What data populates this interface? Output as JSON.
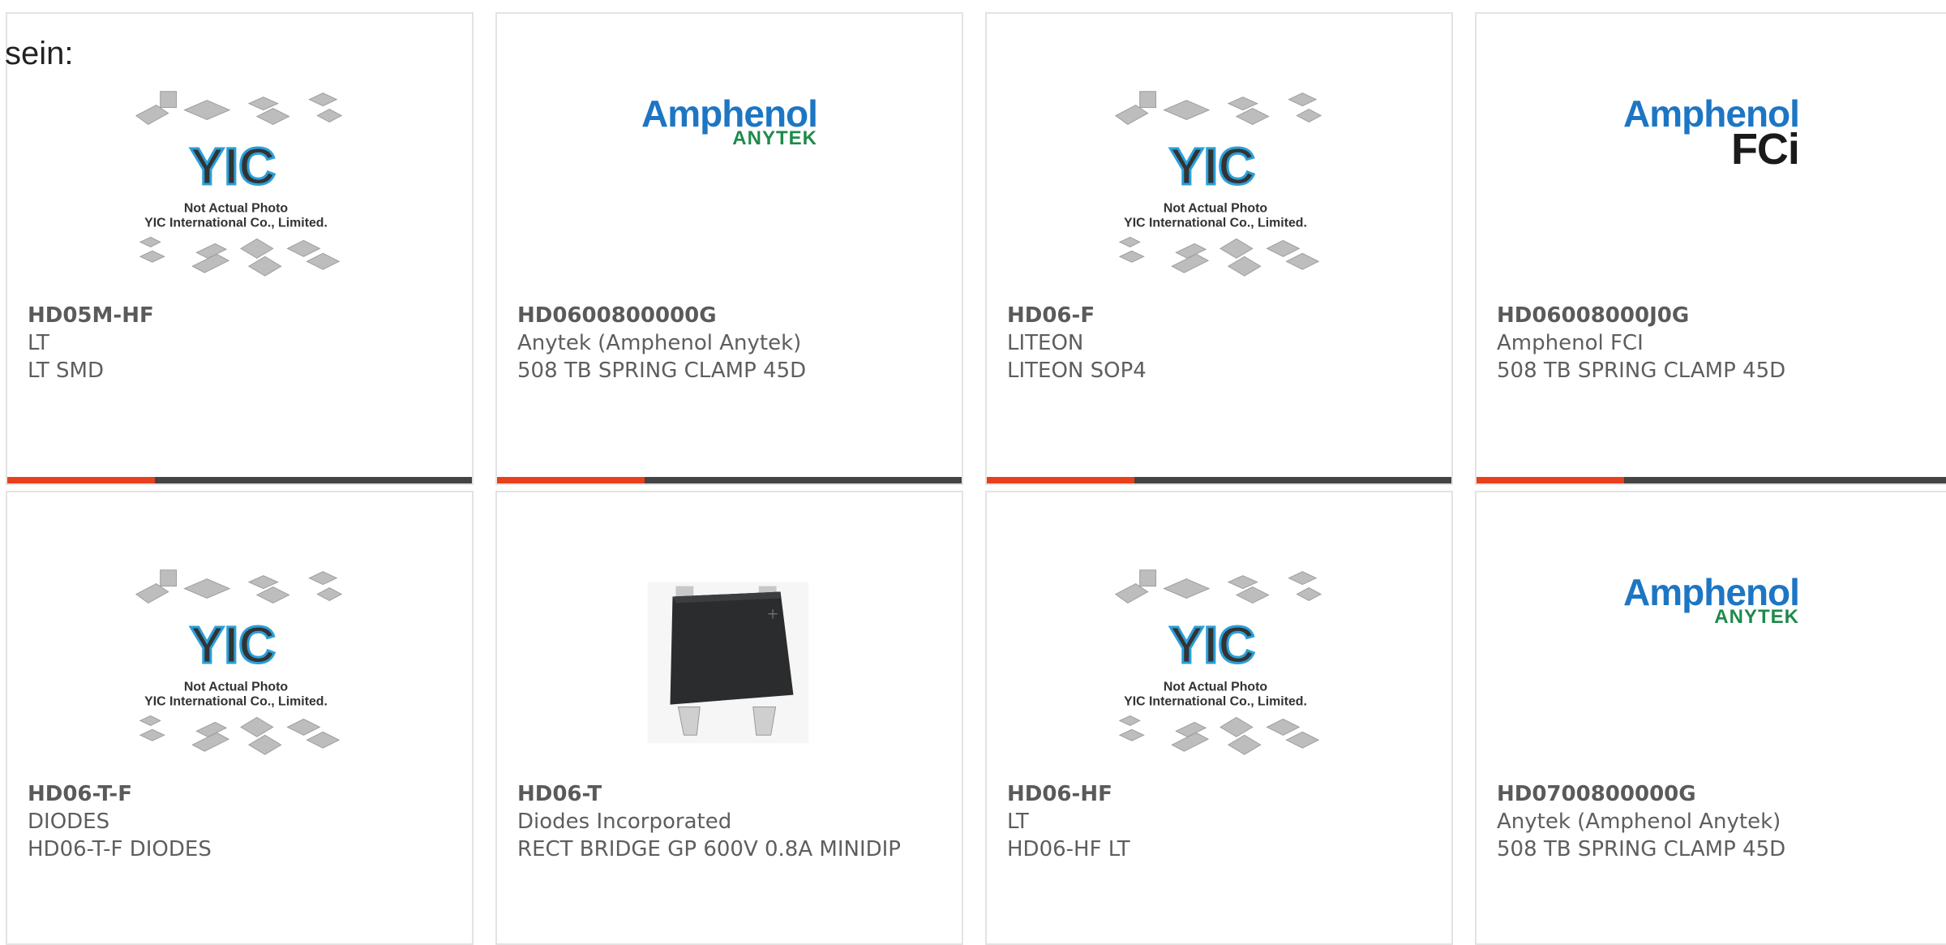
{
  "intro_text": "sein:",
  "colors": {
    "accent": "#e8401c",
    "bar": "#444444",
    "border": "#e3e3e3"
  },
  "placeholder": {
    "line1": "Not Actual Photo",
    "line2": "YIC International Co., Limited.",
    "logo": "YIC"
  },
  "logos": {
    "amphenol": "Amphenol",
    "anytek": "ANYTEK",
    "fci": "FCi"
  },
  "cards": [
    {
      "part": "HD05M-HF",
      "maker": "LT",
      "desc": "LT SMD",
      "image": "yic-placeholder"
    },
    {
      "part": "HD0600800000G",
      "maker": "Anytek (Amphenol Anytek)",
      "desc": "508 TB SPRING CLAMP 45D",
      "image": "amphenol-anytek-logo"
    },
    {
      "part": "HD06-F",
      "maker": "LITEON",
      "desc": "LITEON SOP4",
      "image": "yic-placeholder"
    },
    {
      "part": "HD06008000J0G",
      "maker": "Amphenol FCI",
      "desc": "508 TB SPRING CLAMP 45D",
      "image": "amphenol-fci-logo"
    },
    {
      "part": "HD06-T-F",
      "maker": "DIODES",
      "desc": "HD06-T-F DIODES",
      "image": "yic-placeholder"
    },
    {
      "part": "HD06-T",
      "maker": "Diodes Incorporated",
      "desc": "RECT BRIDGE GP 600V 0.8A MINIDIP",
      "image": "minidip-photo"
    },
    {
      "part": "HD06-HF",
      "maker": "LT",
      "desc": "HD06-HF LT",
      "image": "yic-placeholder"
    },
    {
      "part": "HD0700800000G",
      "maker": "Anytek (Amphenol Anytek)",
      "desc": "508 TB SPRING CLAMP 45D",
      "image": "amphenol-anytek-logo"
    }
  ]
}
